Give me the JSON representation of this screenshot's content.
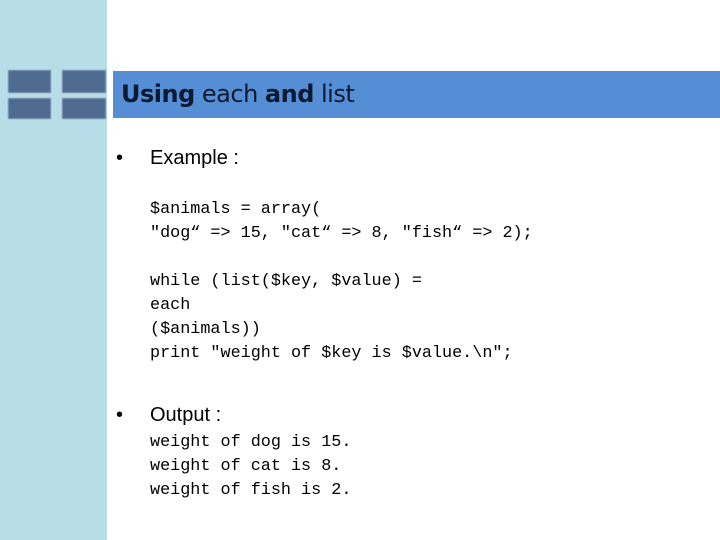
{
  "slide": {
    "title_parts": [
      {
        "text": "Using",
        "weight": "bold"
      },
      {
        "text": " each ",
        "weight": "regular"
      },
      {
        "text": "and",
        "weight": "bold"
      },
      {
        "text": " list",
        "weight": "regular"
      }
    ],
    "bullets": [
      {
        "marker": "•",
        "label": "Example :"
      },
      {
        "marker": "•",
        "label": "Output :"
      }
    ],
    "code_block_1": [
      "$animals = array(",
      "\"dog“ => 15, \"cat“ => 8, \"fish“ => 2);"
    ],
    "code_block_2": [
      "while (list($key, $value) =",
      "each",
      "($animals))",
      "print \"weight of $key is $value.\\n\";"
    ],
    "output_lines": [
      "weight of dog is 15.",
      "weight of cat is 8.",
      "weight of fish is 2."
    ]
  },
  "colors": {
    "sidebar": "#b7dde8",
    "title_bar": "#558ed5",
    "squares": "#4f6a8f"
  }
}
